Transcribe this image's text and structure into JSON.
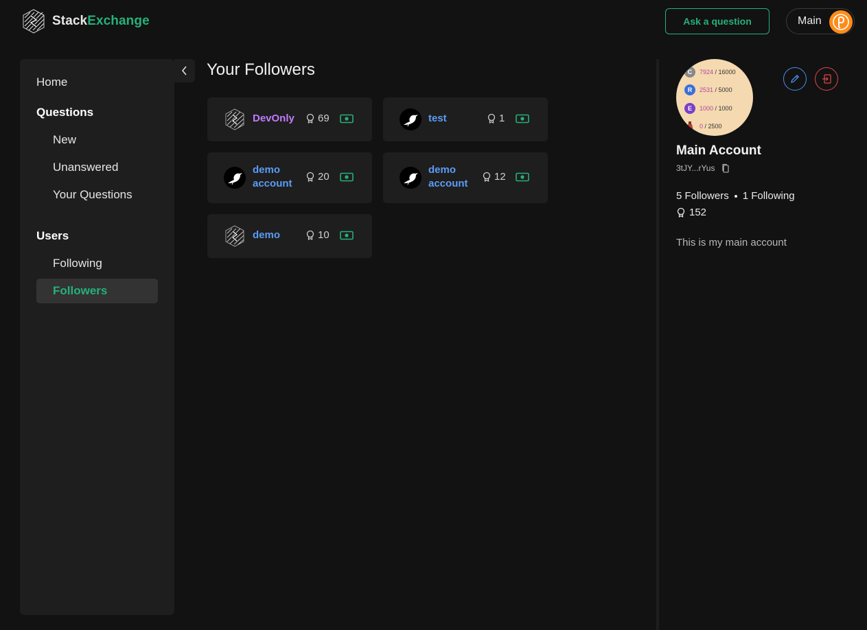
{
  "brand": {
    "stack": "Stack",
    "exchange": "Exchange"
  },
  "header": {
    "ask_label": "Ask a question",
    "account_label": "Main"
  },
  "sidebar": {
    "home": "Home",
    "questions_heading": "Questions",
    "new": "New",
    "unanswered": "Unanswered",
    "your_questions": "Your Questions",
    "users_heading": "Users",
    "following": "Following",
    "followers": "Followers"
  },
  "main": {
    "title": "Your Followers",
    "followers": [
      {
        "name": "DevOnly",
        "reputation": "69",
        "avatar": "stack-logo",
        "name_color": "#c07cff"
      },
      {
        "name": "test",
        "reputation": "1",
        "avatar": "bird",
        "name_color": "#5b9cf6"
      },
      {
        "name": "demo account",
        "reputation": "20",
        "avatar": "bird",
        "name_color": "#5b9cf6"
      },
      {
        "name": "demo account",
        "reputation": "12",
        "avatar": "bird",
        "name_color": "#5b9cf6"
      },
      {
        "name": "demo",
        "reputation": "10",
        "avatar": "stack-logo",
        "name_color": "#5b9cf6"
      }
    ]
  },
  "profile": {
    "name": "Main Account",
    "address": "3tJY...rYus",
    "followers": "5 Followers",
    "following": "1 Following",
    "reputation": "152",
    "bio": "This is my main account",
    "stats": [
      {
        "badge": "C",
        "value": "7924",
        "max": "/ 16000"
      },
      {
        "badge": "R",
        "value": "2531",
        "max": "/ 5000"
      },
      {
        "badge": "E",
        "value": "1000",
        "max": "/ 1000"
      },
      {
        "badge": "",
        "value": "0",
        "max": "/ 2500"
      }
    ]
  },
  "colors": {
    "accent": "#26b07a",
    "background": "#121212",
    "panel": "#1e1e1e",
    "danger": "#e04848",
    "info": "#4a8ef0"
  }
}
